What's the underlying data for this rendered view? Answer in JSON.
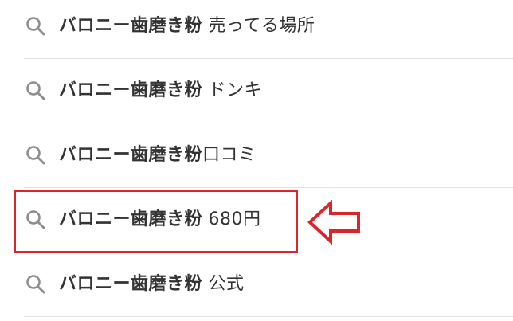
{
  "suggestions": [
    {
      "bold": "バロニー歯磨き粉",
      "rest": " 売ってる場所"
    },
    {
      "bold": "バロニー歯磨き粉",
      "rest": " ドンキ"
    },
    {
      "bold": "バロニー歯磨き粉",
      "rest": "口コミ"
    },
    {
      "bold": "バロニー歯磨き粉",
      "rest": " 680円"
    },
    {
      "bold": "バロニー歯磨き粉",
      "rest": " 公式"
    }
  ],
  "highlighted_index": 3,
  "colors": {
    "highlight": "#d9252b",
    "icon": "#8e8e8e",
    "divider": "#e2e2e2",
    "text": "#333333"
  },
  "icons": {
    "search": "search-icon",
    "annotation": "arrow-left-icon"
  }
}
